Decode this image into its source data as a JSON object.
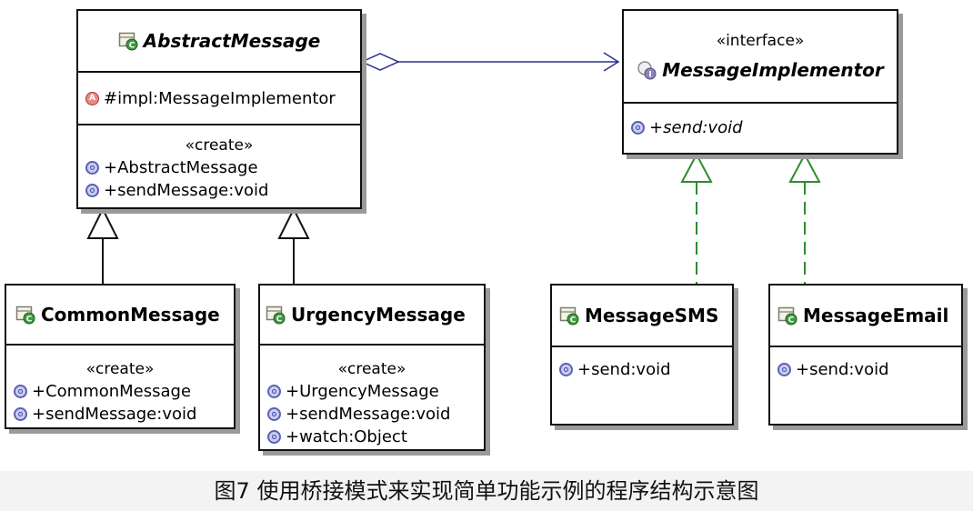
{
  "classes": {
    "abstract_message": {
      "name": "AbstractMessage",
      "field": "#impl:MessageImplementor",
      "stereotype": "«create»",
      "ops": [
        "+AbstractMessage",
        "+sendMessage:void"
      ]
    },
    "message_implementor": {
      "stereotype": "«interface»",
      "name": "MessageImplementor",
      "ops": [
        "+send:void"
      ]
    },
    "common_message": {
      "name": "CommonMessage",
      "stereotype": "«create»",
      "ops": [
        "+CommonMessage",
        "+sendMessage:void"
      ]
    },
    "urgency_message": {
      "name": "UrgencyMessage",
      "stereotype": "«create»",
      "ops": [
        "+UrgencyMessage",
        "+sendMessage:void",
        "+watch:Object"
      ]
    },
    "message_sms": {
      "name": "MessageSMS",
      "ops": [
        "+send:void"
      ]
    },
    "message_email": {
      "name": "MessageEmail",
      "ops": [
        "+send:void"
      ]
    }
  },
  "icons": {
    "class": "class-icon",
    "interface": "interface-icon",
    "operation": "public-operation-icon",
    "field": "abstract-field-icon",
    "field_letter": "A",
    "interface_letter": "I",
    "class_letter": "C"
  },
  "colors": {
    "aggregation_line": "#2b2f8f",
    "realization_line": "#2e8b2e",
    "generalization_line": "#111111"
  },
  "caption": "图7  使用桥接模式来实现简单功能示例的程序结构示意图"
}
